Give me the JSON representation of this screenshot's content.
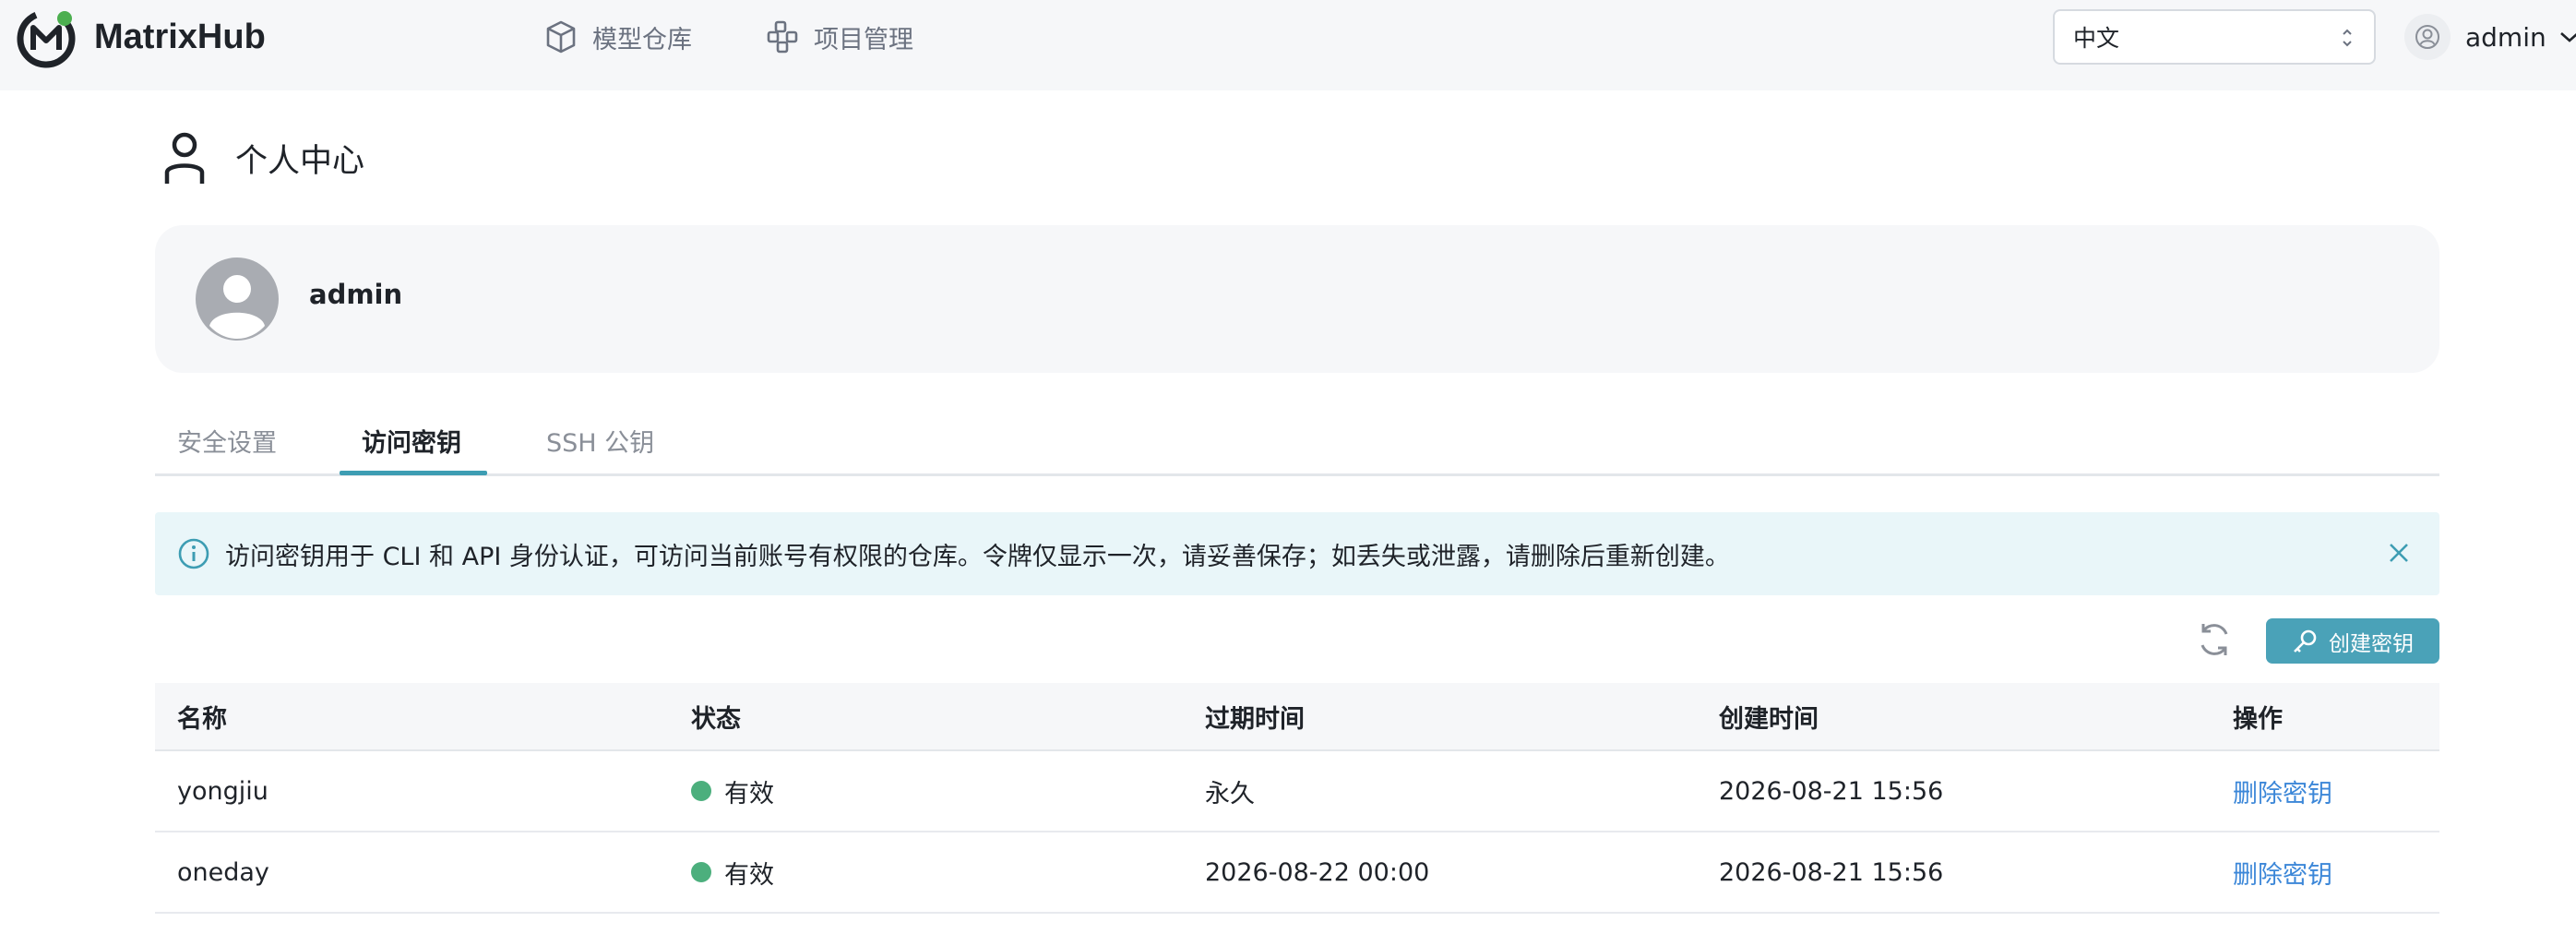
{
  "header": {
    "brand": "MatrixHub",
    "nav": [
      {
        "label": "模型仓库",
        "icon": "cube-icon"
      },
      {
        "label": "项目管理",
        "icon": "project-icon"
      }
    ],
    "language": {
      "selected": "中文"
    },
    "user": {
      "name": "admin"
    }
  },
  "page": {
    "title": "个人中心"
  },
  "profile": {
    "name": "admin"
  },
  "tabs": [
    {
      "label": "安全设置",
      "active": false
    },
    {
      "label": "访问密钥",
      "active": true
    },
    {
      "label": "SSH 公钥",
      "active": false
    }
  ],
  "alert": {
    "text": "访问密钥用于 CLI 和 API 身份认证，可访问当前账号有权限的仓库。令牌仅显示一次，请妥善保存；如丢失或泄露，请删除后重新创建。"
  },
  "toolbar": {
    "create_label": "创建密钥"
  },
  "table": {
    "columns": [
      "名称",
      "状态",
      "过期时间",
      "创建时间",
      "操作"
    ],
    "rows": [
      {
        "name": "yongjiu",
        "status": "有效",
        "expires": "永久",
        "created": "2026-08-21 15:56",
        "action": "删除密钥"
      },
      {
        "name": "oneday",
        "status": "有效",
        "expires": "2026-08-22 00:00",
        "created": "2026-08-21 15:56",
        "action": "删除密钥"
      }
    ]
  },
  "colors": {
    "accent": "#4aa2b8",
    "status_valid": "#4caf7d",
    "link": "#3c87d8"
  }
}
